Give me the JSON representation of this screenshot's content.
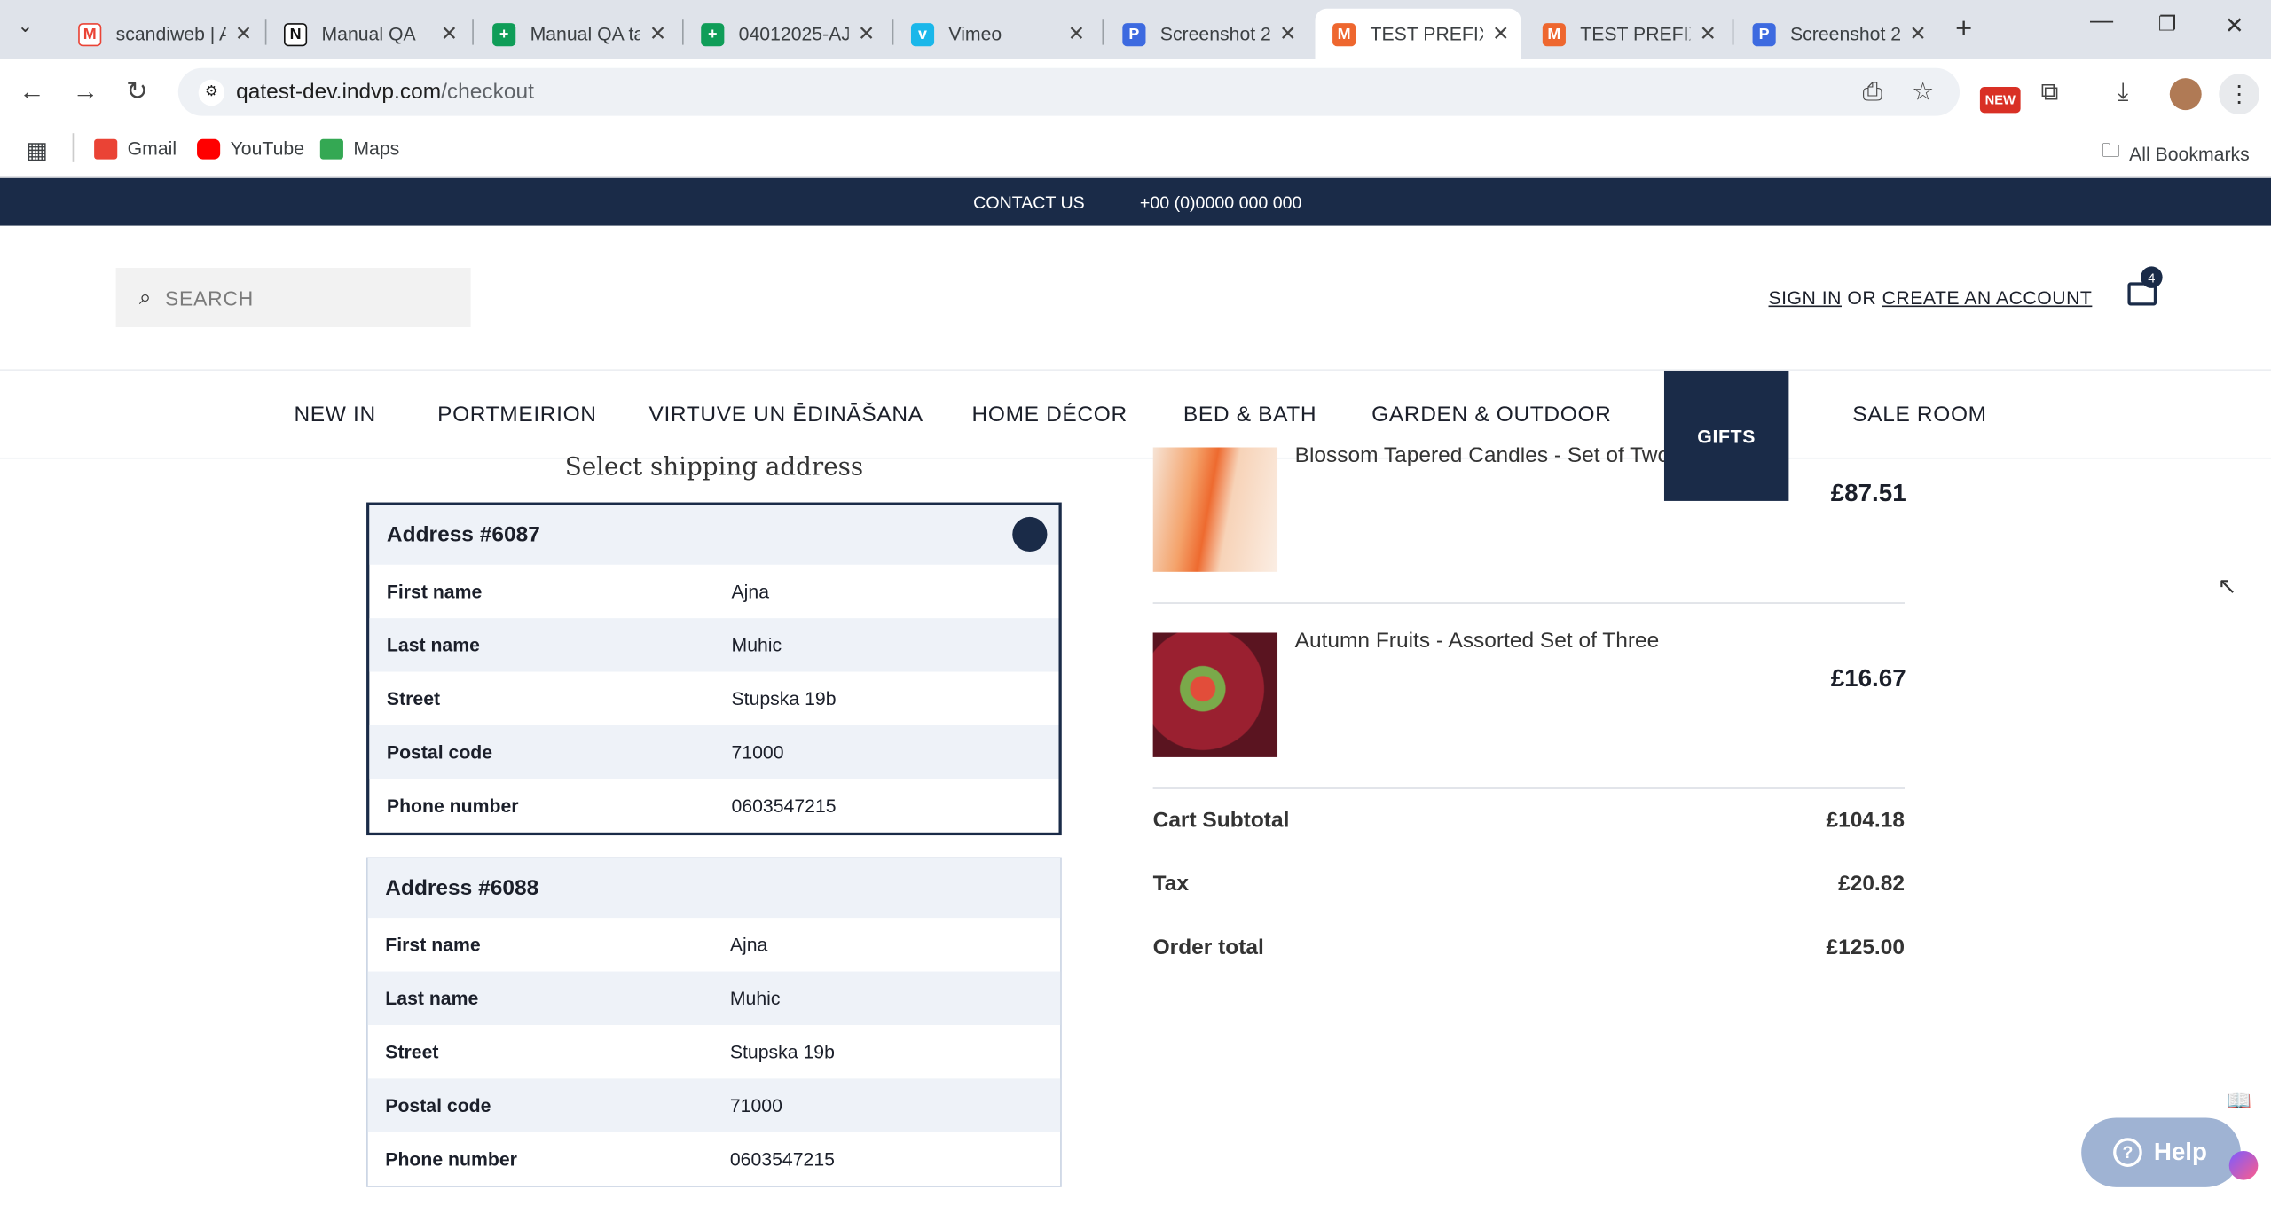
{
  "browser": {
    "tabs": [
      {
        "label": "scandiweb | A",
        "favicon": "gmail-icon",
        "color": "#ea4335"
      },
      {
        "label": "Manual QA",
        "favicon": "notion-icon",
        "color": "#111111"
      },
      {
        "label": "Manual QA ta",
        "favicon": "sheets-icon",
        "color": "#0f9d58"
      },
      {
        "label": "04012025-AJ",
        "favicon": "sheets-icon",
        "color": "#0f9d58"
      },
      {
        "label": "Vimeo",
        "favicon": "vimeo-icon",
        "color": "#1ab7ea"
      },
      {
        "label": "Screenshot 2",
        "favicon": "screenshot-icon",
        "color": "#3d6ae0"
      },
      {
        "label": "TEST PREFIX",
        "favicon": "magento-icon",
        "color": "#ee672f"
      },
      {
        "label": "TEST PREFIX",
        "favicon": "magento-icon",
        "color": "#ee672f"
      },
      {
        "label": "Screenshot 2",
        "favicon": "screenshot-icon",
        "color": "#3d6ae0"
      }
    ],
    "url_host": "qatest-dev.indvp.com",
    "url_path": "/checkout",
    "new_badge": "NEW",
    "bookmarks": [
      {
        "label": "Gmail",
        "color": "#ea4335"
      },
      {
        "label": "YouTube",
        "color": "#ff0000"
      },
      {
        "label": "Maps",
        "color": "#34a853"
      }
    ],
    "all_bookmarks": "All Bookmarks"
  },
  "site": {
    "contact_label": "CONTACT US",
    "phone": "+00 (0)0000 000 000",
    "search_placeholder": "SEARCH",
    "sign_in": "SIGN IN",
    "or": "OR",
    "create_account": "CREATE AN ACCOUNT",
    "cart_count": "4",
    "nav": [
      "NEW IN",
      "PORTMEIRION",
      "VIRTUVE UN ĒDINĀŠANA",
      "HOME DÉCOR",
      "BED & BATH",
      "GARDEN & OUTDOOR",
      "GIFTS",
      "SALE ROOM"
    ],
    "brand_color": "#1a2b48"
  },
  "checkout": {
    "section_title": "Select shipping address",
    "addresses": [
      {
        "title": "Address #6087",
        "selected": true,
        "rows": [
          {
            "k": "First name",
            "v": "Ajna"
          },
          {
            "k": "Last name",
            "v": "Muhic"
          },
          {
            "k": "Street",
            "v": "Stupska 19b"
          },
          {
            "k": "Postal code",
            "v": "71000"
          },
          {
            "k": "Phone number",
            "v": "0603547215"
          }
        ]
      },
      {
        "title": "Address #6088",
        "selected": false,
        "rows": [
          {
            "k": "First name",
            "v": "Ajna"
          },
          {
            "k": "Last name",
            "v": "Muhic"
          },
          {
            "k": "Street",
            "v": "Stupska 19b"
          },
          {
            "k": "Postal code",
            "v": "71000"
          },
          {
            "k": "Phone number",
            "v": "0603547215"
          }
        ]
      }
    ],
    "products": [
      {
        "name": "Blossom Tapered Candles - Set of Two",
        "price": "£87.51"
      },
      {
        "name": "Autumn Fruits - Assorted Set of Three",
        "price": "£16.67"
      }
    ],
    "summary": [
      {
        "label": "Cart Subtotal",
        "value": "£104.18"
      },
      {
        "label": "Tax",
        "value": "£20.82"
      },
      {
        "label": "Order total",
        "value": "£125.00"
      }
    ],
    "help_label": "Help"
  }
}
